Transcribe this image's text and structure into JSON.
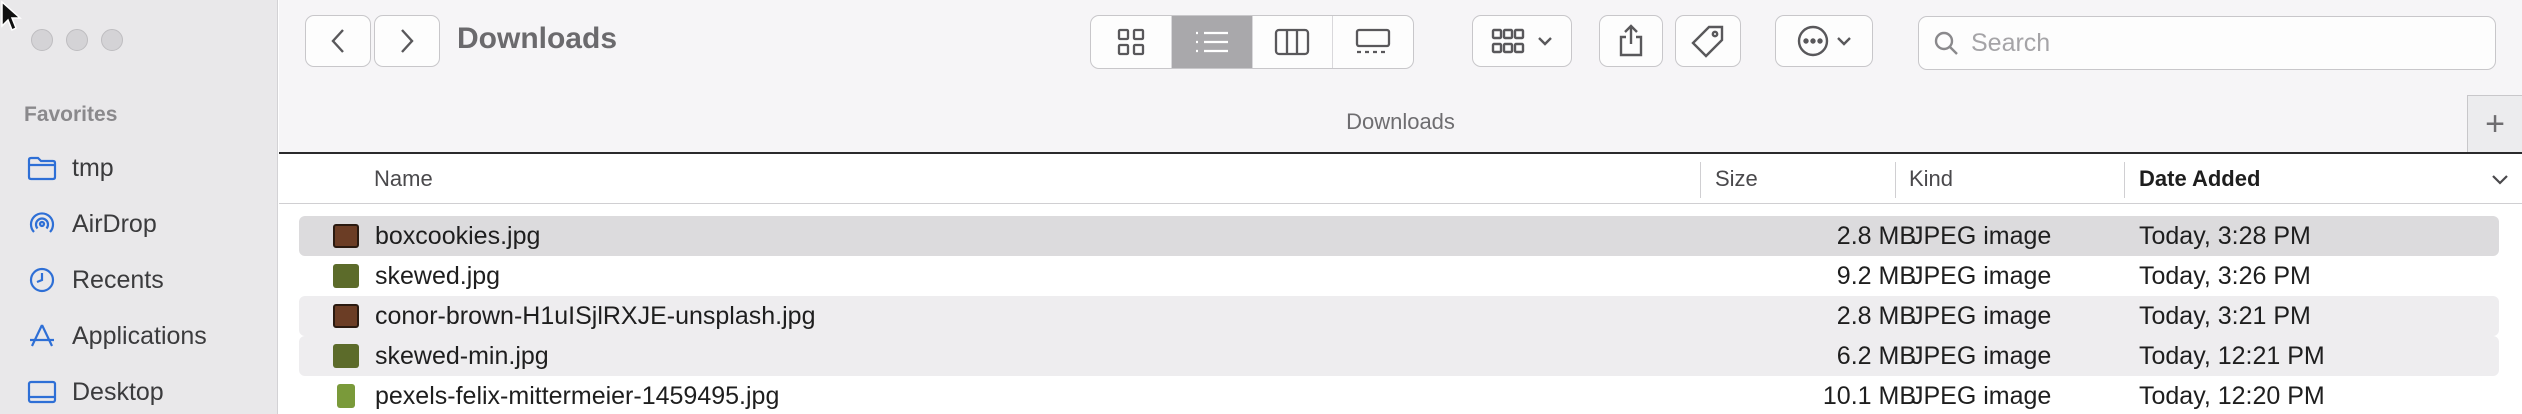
{
  "sidebar": {
    "section_label": "Favorites",
    "items": [
      {
        "label": "tmp",
        "icon": "folder-icon"
      },
      {
        "label": "AirDrop",
        "icon": "airdrop-icon"
      },
      {
        "label": "Recents",
        "icon": "clock-icon"
      },
      {
        "label": "Applications",
        "icon": "applications-icon"
      },
      {
        "label": "Desktop",
        "icon": "desktop-icon"
      }
    ]
  },
  "toolbar": {
    "title": "Downloads",
    "search_placeholder": "Search",
    "active_view": "list"
  },
  "pathbar": {
    "label": "Downloads",
    "add_label": "+"
  },
  "columns": {
    "name": "Name",
    "size": "Size",
    "kind": "Kind",
    "date_added": "Date Added"
  },
  "files": [
    {
      "name": "boxcookies.jpg",
      "size": "2.8 MB",
      "kind": "JPEG image",
      "date_added": "Today, 3:28 PM",
      "thumb_color": "#6b3d25"
    },
    {
      "name": "skewed.jpg",
      "size": "9.2 MB",
      "kind": "JPEG image",
      "date_added": "Today, 3:26 PM",
      "thumb_color": "#5c6b2a"
    },
    {
      "name": "conor-brown-H1uISjlRXJE-unsplash.jpg",
      "size": "2.8 MB",
      "kind": "JPEG image",
      "date_added": "Today, 3:21 PM",
      "thumb_color": "#6b3d25"
    },
    {
      "name": "skewed-min.jpg",
      "size": "6.2 MB",
      "kind": "JPEG image",
      "date_added": "Today, 12:21 PM",
      "thumb_color": "#5c6b2a"
    },
    {
      "name": "pexels-felix-mittermeier-1459495.jpg",
      "size": "10.1 MB",
      "kind": "JPEG image",
      "date_added": "Today, 12:20 PM",
      "thumb_color": "#7a9a3a"
    }
  ],
  "colors": {
    "accent": "#2e6fd6",
    "sidebar_bg": "#e9e8ea",
    "row_stripe": "#eeedef",
    "row_selected": "#dcdbdd"
  }
}
